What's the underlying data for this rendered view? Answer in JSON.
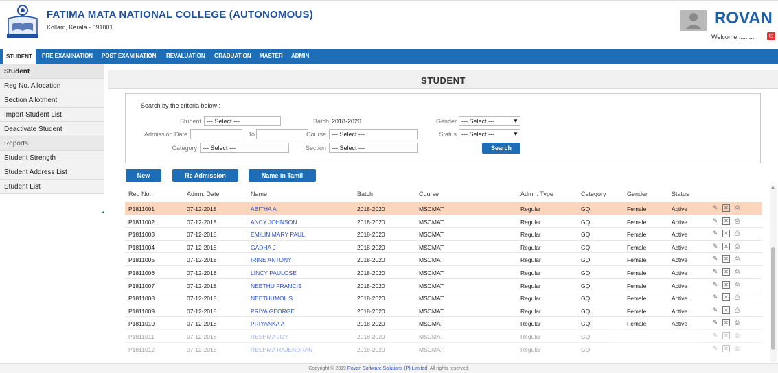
{
  "header": {
    "college_name": "FATIMA MATA NATIONAL COLLEGE (AUTONOMOUS)",
    "college_address": "Kollam, Kerala - 691001.",
    "brand": "ROVAN",
    "welcome": "Welcome ..........",
    "brand_color": "#1f5fa8",
    "icons": {
      "logo": "college-emblem",
      "user": "user-avatar",
      "logout": "power-icon"
    }
  },
  "nav": {
    "items": [
      "STUDENT",
      "PRE EXAMINATION",
      "POST EXAMINATION",
      "REVALUATION",
      "GRADUATION",
      "MASTER",
      "ADMIN"
    ],
    "active": "STUDENT",
    "color": "#1d6eb7"
  },
  "sidebar": {
    "items": [
      {
        "label": "Student",
        "kind": "heading"
      },
      {
        "label": "Reg No. Allocation",
        "kind": "item"
      },
      {
        "label": "Section Allotment",
        "kind": "item"
      },
      {
        "label": "Import Student List",
        "kind": "item"
      },
      {
        "label": "Deactivate Student",
        "kind": "item"
      },
      {
        "label": "Reports",
        "kind": "section"
      },
      {
        "label": "Student Strength",
        "kind": "item"
      },
      {
        "label": "Student Address List",
        "kind": "item"
      },
      {
        "label": "Student List",
        "kind": "item"
      }
    ]
  },
  "main": {
    "title": "STUDENT",
    "search": {
      "hint": "Search by the criteria below :",
      "student_label": "Student",
      "student_value": "--- Select ---",
      "admission_date_label": "Admission Date",
      "to_label": "To",
      "category_label": "Category",
      "category_value": "--- Select ---",
      "batch_label": "Batch",
      "batch_value": "2018-2020",
      "course_label": "Course",
      "course_value": "--- Select ---",
      "section_label": "Section",
      "section_value": "--- Select ---",
      "gender_label": "Gender",
      "gender_value": "--- Select ---",
      "status_label": "Status",
      "status_value": "--- Select ---",
      "search_button": "Search"
    },
    "actions": {
      "new": "New",
      "readmission": "Re Admission",
      "name_tamil": "Name in Tamil"
    },
    "table": {
      "columns": [
        "Reg No.",
        "Admn. Date",
        "Name",
        "Batch",
        "Course",
        "Admn. Type",
        "Category",
        "Gender",
        "Status"
      ],
      "rows": [
        [
          "P1811001",
          "07-12-2018",
          "ABITHA A",
          "2018-2020",
          "MSCMAT",
          "Regular",
          "GQ",
          "Female",
          "Active"
        ],
        [
          "P1811002",
          "07-12-2018",
          "ANCY JOHNSON",
          "2018-2020",
          "MSCMAT",
          "Regular",
          "GQ",
          "Female",
          "Active"
        ],
        [
          "P1811003",
          "07-12-2018",
          "EMILIN MARY PAUL",
          "2018-2020",
          "MSCMAT",
          "Regular",
          "GQ",
          "Female",
          "Active"
        ],
        [
          "P1811004",
          "07-12-2018",
          "GADHA J",
          "2018-2020",
          "MSCMAT",
          "Regular",
          "GQ",
          "Female",
          "Active"
        ],
        [
          "P1811005",
          "07-12-2018",
          "IRINE ANTONY",
          "2018-2020",
          "MSCMAT",
          "Regular",
          "GQ",
          "Female",
          "Active"
        ],
        [
          "P1811006",
          "07-12-2018",
          "LINCY PAULOSE",
          "2018-2020",
          "MSCMAT",
          "Regular",
          "GQ",
          "Female",
          "Active"
        ],
        [
          "P1811007",
          "07-12-2018",
          "NEETHU FRANCIS",
          "2018-2020",
          "MSCMAT",
          "Regular",
          "GQ",
          "Female",
          "Active"
        ],
        [
          "P1811008",
          "07-12-2018",
          "NEETHUMOL S",
          "2018-2020",
          "MSCMAT",
          "Regular",
          "GQ",
          "Female",
          "Active"
        ],
        [
          "P1811009",
          "07-12-2018",
          "PRIYA GEORGE",
          "2018-2020",
          "MSCMAT",
          "Regular",
          "GQ",
          "Female",
          "Active"
        ],
        [
          "P1811010",
          "07-12-2018",
          "PRIYANKA A",
          "2018-2020",
          "MSCMAT",
          "Regular",
          "GQ",
          "Female",
          "Active"
        ],
        [
          "P1811011",
          "07-12-2018",
          "RESHMA JOY",
          "2018-2020",
          "MSCMAT",
          "Regular",
          "GQ",
          "",
          ""
        ],
        [
          "P1811012",
          "07-12-2018",
          "RESHMA RAJENDRAN",
          "2018-2020",
          "MSCMAT",
          "Regular",
          "GQ",
          "",
          ""
        ]
      ],
      "selected_row": 0,
      "row_icons": [
        "edit-icon",
        "delete-icon",
        "print-icon"
      ],
      "selected_color": "#fcd5bd"
    }
  },
  "footer": {
    "prefix": "Copyright © 2019",
    "company": "Rovan Software Solutions (P) Limited",
    "suffix": ". All rights reserved."
  }
}
